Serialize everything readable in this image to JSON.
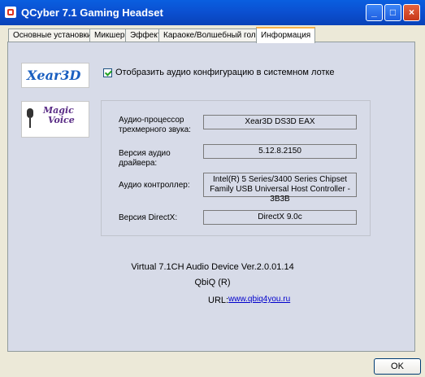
{
  "window": {
    "title": "QCyber 7.1 Gaming Headset"
  },
  "titlebar_buttons": {
    "minimize": "_",
    "maximize": "□",
    "close": "×"
  },
  "tabs": [
    "Основные установки",
    "Микшер",
    "Эффект",
    "Караоке/Волшебный голос",
    "Информация"
  ],
  "logos": {
    "xear_a": "Xear",
    "xear_b": "3D",
    "magic": "Magic",
    "voice": "Voice"
  },
  "checkbox_label": "Отобразить аудио конфигурацию в системном лотке",
  "info_fields": {
    "processor_label": "Аудио-процессор трехмерного звука:",
    "processor_value": "Xear3D  DS3D  EAX",
    "driver_label": "Версия аудио драйвера:",
    "driver_value": "5.12.8.2150",
    "controller_label": "Аудио контроллер:",
    "controller_value": "Intel(R) 5 Series/3400 Series Chipset Family USB Universal Host Controller - 3B3B",
    "directx_label": "Версия DirectX:",
    "directx_value": "DirectX 9.0c"
  },
  "footer": {
    "device": "Virtual 7.1CH Audio Device Ver.2.0.01.14",
    "company": "QbiQ (R)",
    "url_label": "URL:",
    "url": "www.qbiq4you.ru"
  },
  "ok_label": "OK"
}
